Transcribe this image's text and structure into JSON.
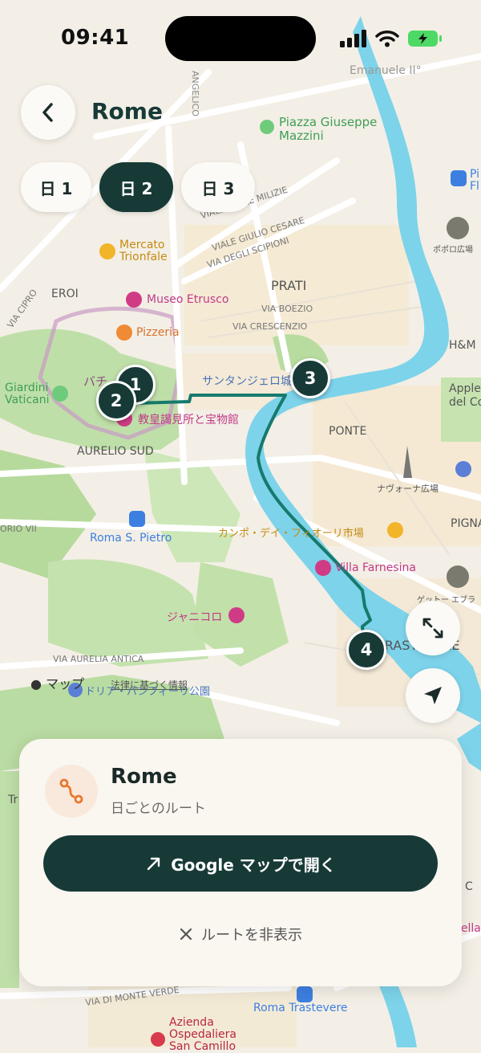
{
  "status_bar": {
    "time": "09:41"
  },
  "header": {
    "title": "Rome"
  },
  "day_tabs": [
    {
      "label": "日 1",
      "active": false
    },
    {
      "label": "日 2",
      "active": true
    },
    {
      "label": "日 3",
      "active": false
    }
  ],
  "route_markers": [
    "1",
    "2",
    "3",
    "4"
  ],
  "map_labels": {
    "emanuele": "Emanuele II°",
    "angelico": "ANGELICO",
    "piazza_mazzini": "Piazza Giuseppe\nMazzini",
    "milizie": "VIALE DELLE MILIZIE",
    "giulio_cesare": "VIALE GIULIO CESARE",
    "scipioni": "VIA DEGLI SCIPIONI",
    "mercato": "Mercato\nTrionfale",
    "popolo": "ポポロ広場",
    "flaminio": "Pi\nFl",
    "eroi": "EROI",
    "via_cipro": "VIA CIPRO",
    "prati": "PRATI",
    "boezio": "VIA BOEZIO",
    "crescenzio": "VIA CRESCENZIO",
    "museo_etrusco": "Museo Etrusco",
    "pizzeria": "Pizzeria",
    "hm": "H&M",
    "vatican": "バチ　国",
    "santangelo": "サンタンジェロ城",
    "giardini": "Giardini\nVaticani",
    "apple": "Apple\ndel Co",
    "museum_jp": "教皇謁見所と宝物館",
    "aurelio": "AURELIO SUD",
    "ponte": "PONTE",
    "navona": "ナヴォーナ広場",
    "gregorio": "ORIO VII",
    "roma_pietro": "Roma S. Pietro",
    "campo": "カンポ・デイ・フィオーリ市場",
    "pigna": "PIGNA",
    "farnesina": "Villa Farnesina",
    "ghetto": "ゲットー エブラ",
    "gianicolo": "ジャニコロ",
    "trastevere": "TRASTEVERE",
    "aurelia_antica": "VIA AURELIA ANTICA",
    "maps_brand": "マップ",
    "legal": "法律に基づく情報",
    "pamphili": "ドリア・パンフィーリ公園",
    "tr": "Tr",
    "cc": "C",
    "della": "della",
    "monte_verde": "VIA DI MONTE VERDE",
    "roma_trastevere": "Roma Trastevere",
    "ospedale": "Azienda\nOspedaliera\nSan Camillo"
  },
  "route_card": {
    "title": "Rome",
    "subtitle": "日ごとのルート",
    "open_button": "Google マップで開く",
    "hide_route": "ルートを非表示"
  },
  "colors": {
    "primary": "#173a37",
    "route": "#167a6c",
    "water": "#7dd3ea",
    "park": "#b7dc9f",
    "accent_icon": "#e8782c"
  }
}
